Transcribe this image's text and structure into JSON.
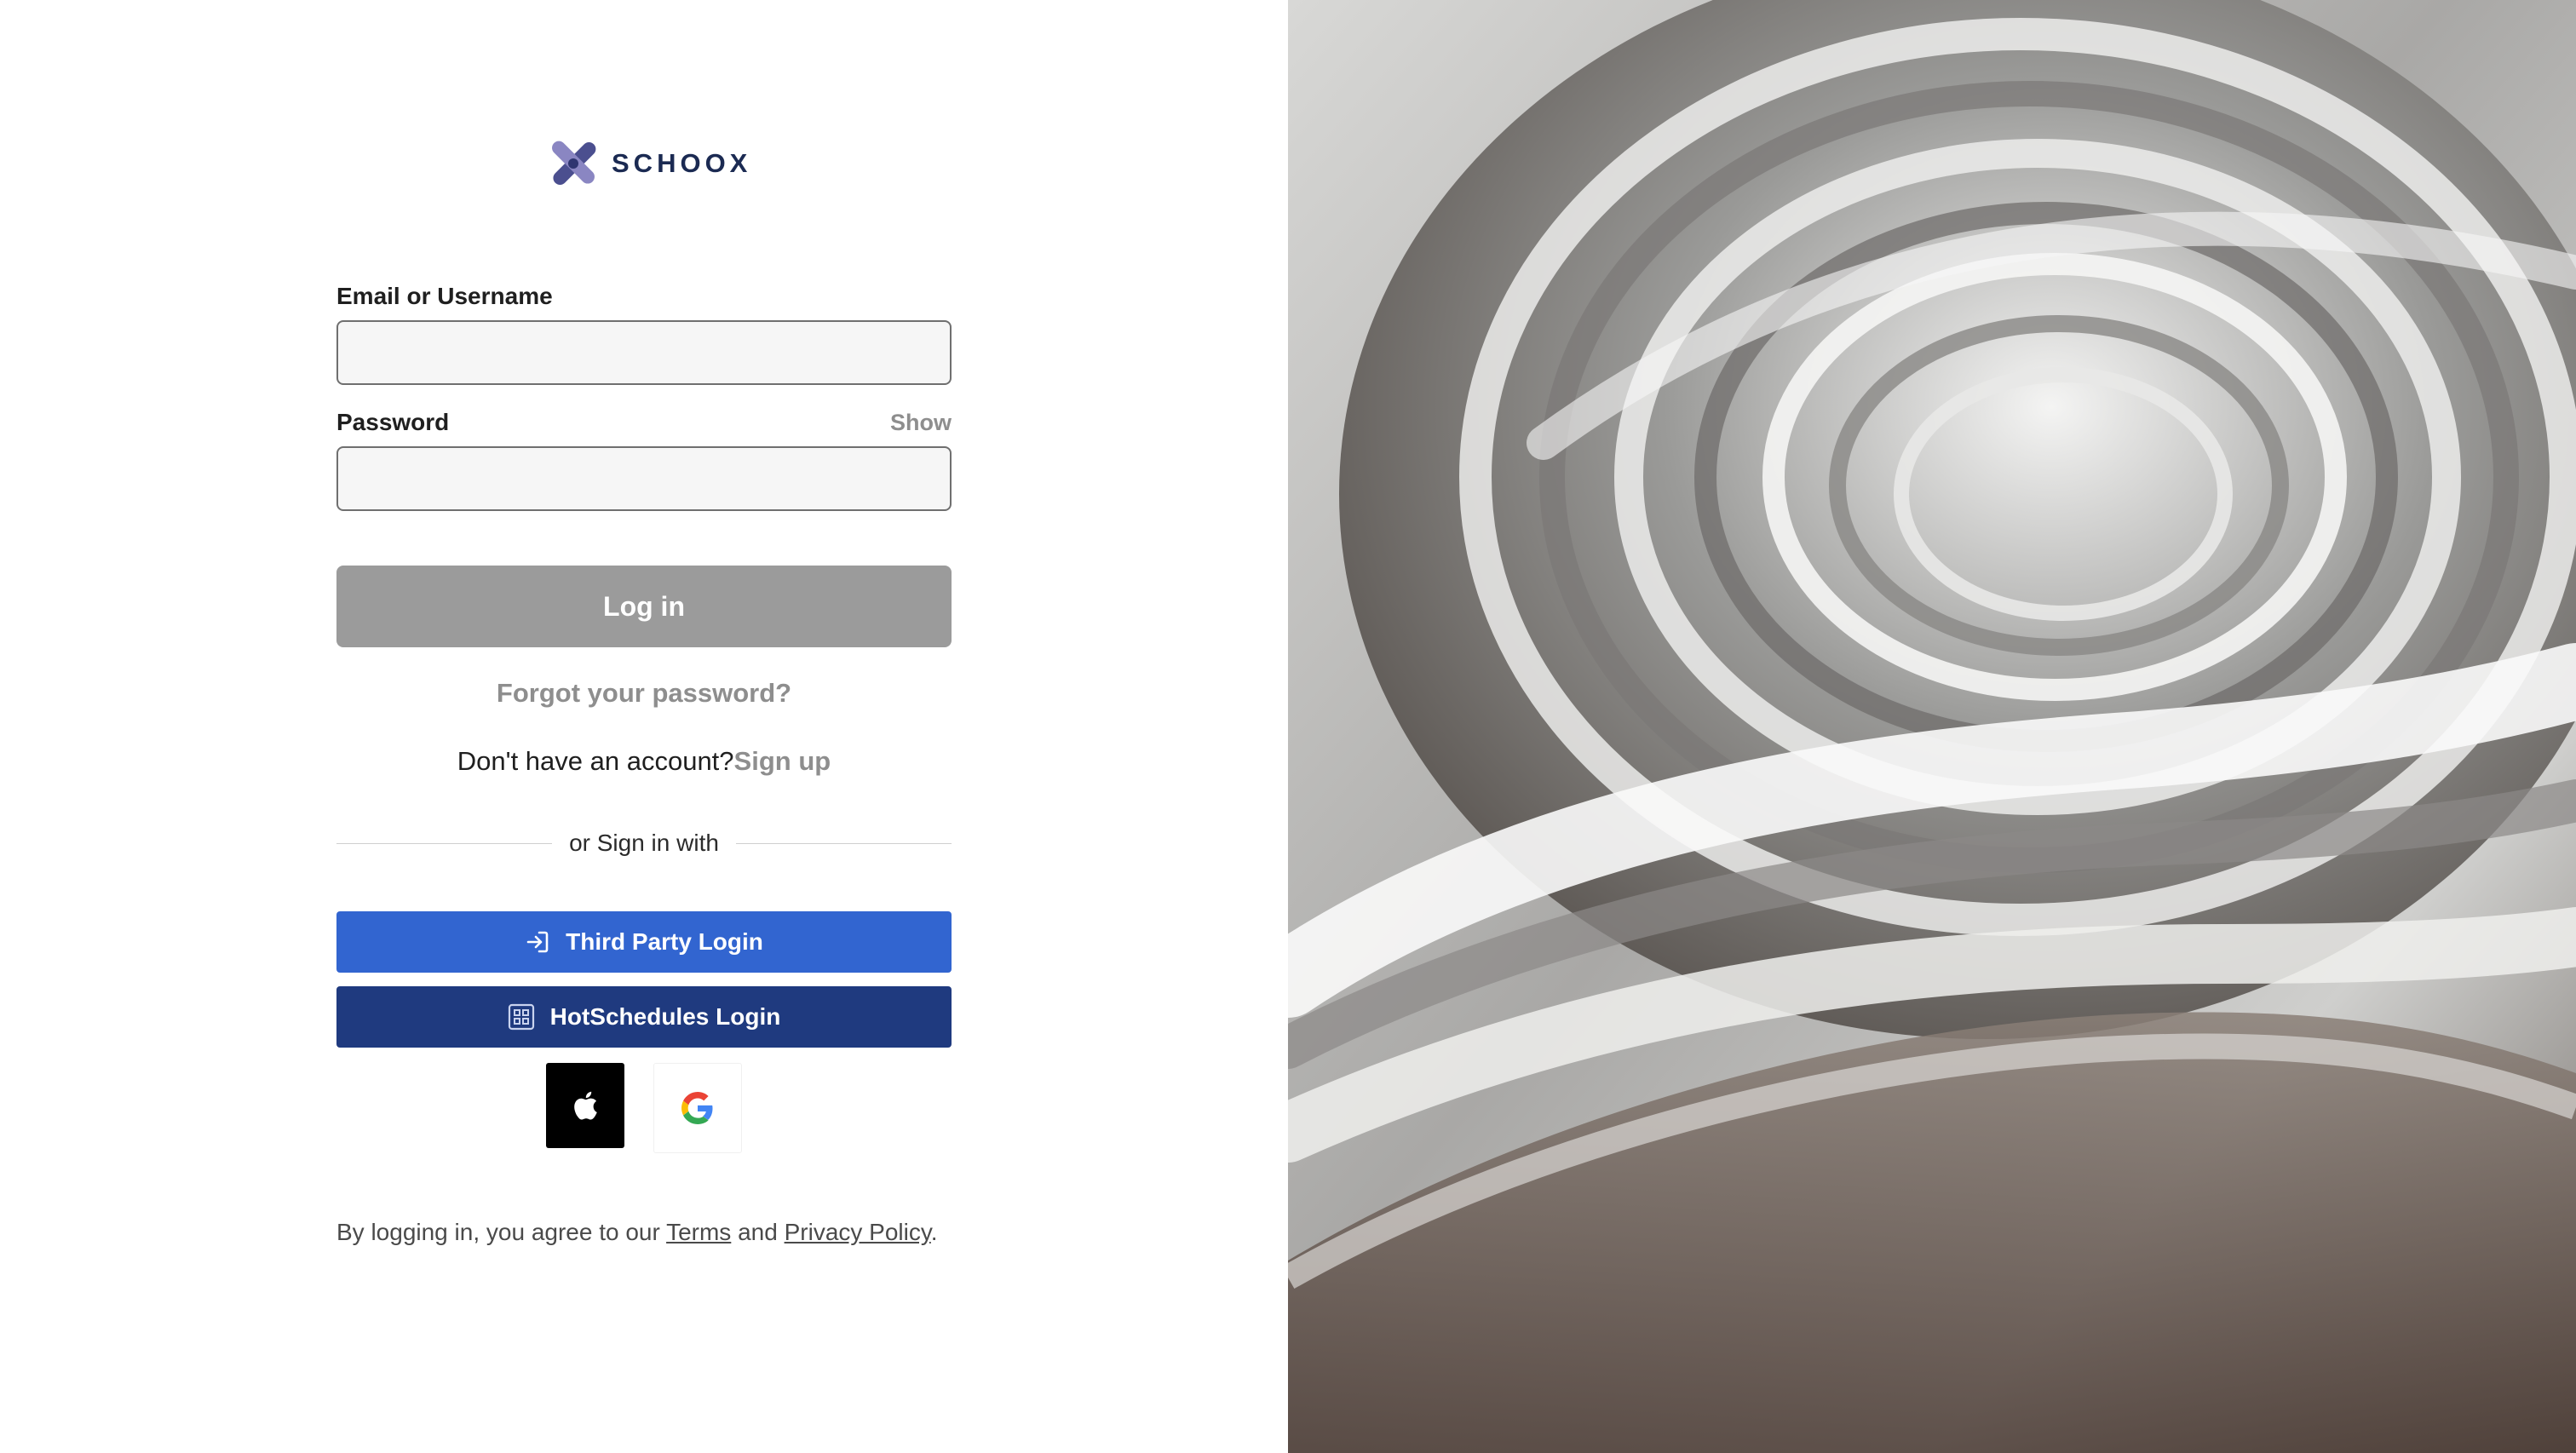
{
  "brand": {
    "name": "SCHOOX"
  },
  "form": {
    "email_label": "Email or Username",
    "email_value": "",
    "password_label": "Password",
    "password_value": "",
    "show_label": "Show",
    "login_label": "Log in",
    "forgot_label": "Forgot your password?",
    "no_account_text": "Don't have an account?",
    "signup_label": "Sign up",
    "divider_text": "or Sign in with"
  },
  "sso": {
    "third_party_label": "Third Party Login",
    "hotschedules_label": "HotSchedules Login"
  },
  "social": [
    "apple-icon",
    "google-icon"
  ],
  "legal": {
    "prefix": "By logging in, you agree to our ",
    "terms_label": "Terms",
    "and": " and ",
    "privacy_label": "Privacy Policy",
    "suffix": "."
  },
  "colors": {
    "brand_dark": "#1b2a52",
    "third_party_blue": "#3265d0",
    "hotschedules_navy": "#1f3a7f",
    "login_disabled": "#9b9b9b",
    "link_gray": "#8e8e8e"
  }
}
